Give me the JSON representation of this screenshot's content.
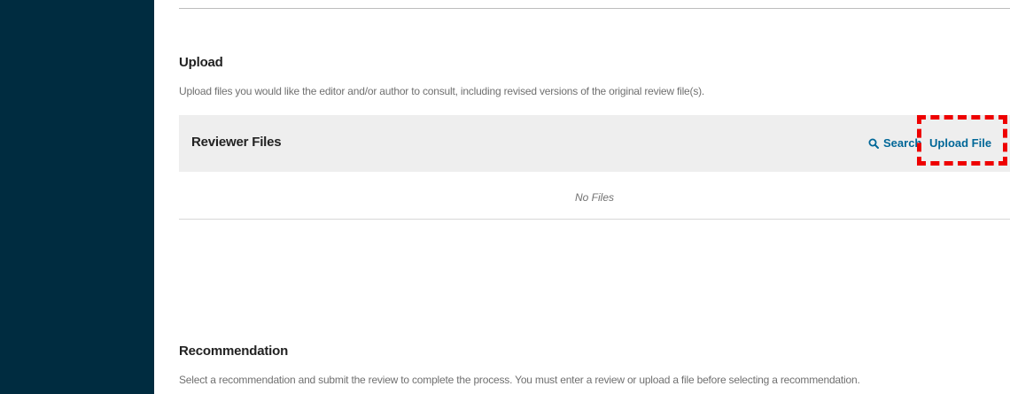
{
  "upload": {
    "title": "Upload",
    "description": "Upload files you would like the editor and/or author to consult, including revised versions of the original review file(s)."
  },
  "reviewer_files": {
    "title": "Reviewer Files",
    "search_label": "Search",
    "upload_label": "Upload File",
    "empty_text": "No Files"
  },
  "recommendation": {
    "title": "Recommendation",
    "description": "Select a recommendation and submit the review to complete the process. You must enter a review or upload a file before selecting a recommendation."
  },
  "colors": {
    "sidebar": "#002c40",
    "link": "#006798",
    "highlight": "#ee0000"
  },
  "icons": {
    "search": "search-icon"
  }
}
